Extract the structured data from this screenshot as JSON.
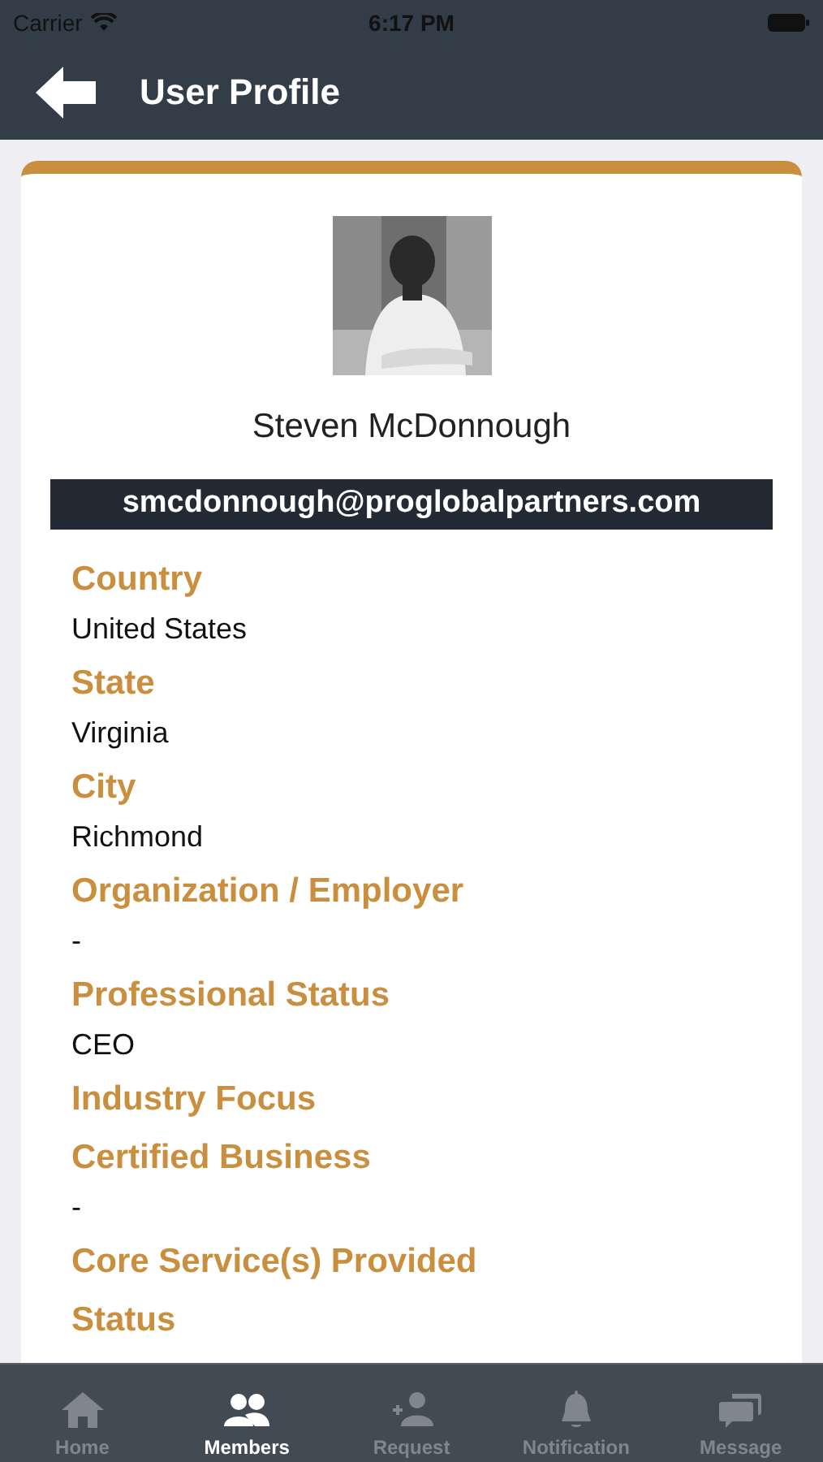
{
  "status_bar": {
    "carrier": "Carrier",
    "time": "6:17 PM"
  },
  "header": {
    "title": "User Profile"
  },
  "profile": {
    "name": "Steven McDonnough",
    "email": "smcdonnough@proglobalpartners.com"
  },
  "fields": [
    {
      "label": "Country",
      "value": "United States"
    },
    {
      "label": "State",
      "value": "Virginia"
    },
    {
      "label": "City",
      "value": "Richmond"
    },
    {
      "label": "Organization / Employer",
      "value": "-"
    },
    {
      "label": "Professional Status",
      "value": "CEO"
    },
    {
      "label": "Industry Focus"
    },
    {
      "label": "Certified Business",
      "value": "-"
    },
    {
      "label": "Core Service(s) Provided"
    },
    {
      "label": "Status"
    }
  ],
  "tabs": [
    {
      "label": "Home",
      "kind": "home",
      "selected": false
    },
    {
      "label": "Members",
      "kind": "members",
      "selected": true
    },
    {
      "label": "Request",
      "kind": "request",
      "selected": false
    },
    {
      "label": "Notification",
      "kind": "notification",
      "selected": false
    },
    {
      "label": "Message",
      "kind": "message",
      "selected": false
    }
  ]
}
